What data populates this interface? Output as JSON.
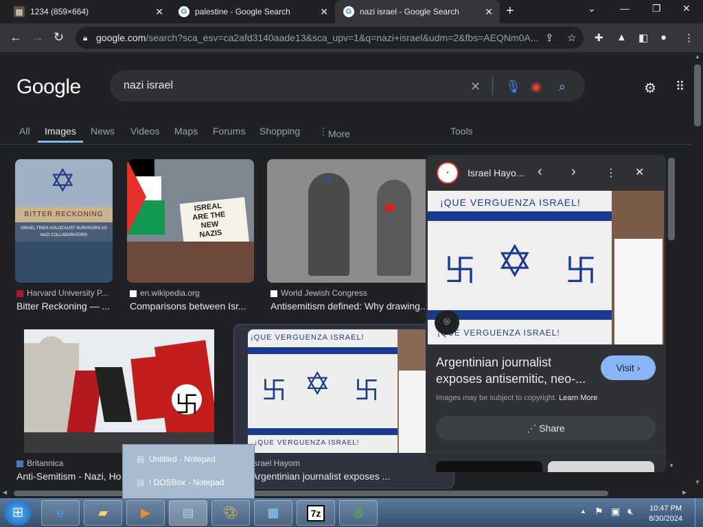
{
  "tabs": [
    {
      "title": "1234 (859×664)",
      "active": false
    },
    {
      "title": "palestine - Google Search",
      "active": false
    },
    {
      "title": "nazi israel - Google Search",
      "active": true
    }
  ],
  "address": {
    "host": "google.com",
    "path": "/search?sca_esv=ca2afd3140aade13&sca_upv=1&q=nazi+israel&udm=2&fbs=AEQNm0A..."
  },
  "logo": "Google",
  "search": {
    "query": "nazi israel"
  },
  "nav": {
    "all": "All",
    "images": "Images",
    "news": "News",
    "videos": "Videos",
    "maps": "Maps",
    "forums": "Forums",
    "shopping": "Shopping",
    "more": "More",
    "tools": "Tools"
  },
  "results": [
    {
      "source": "Harvard University P...",
      "title": "Bitter Reckoning — ...",
      "thumb_text": "BITTER RECKONING",
      "thumb_sub": "ISRAEL TRIES HOLOCAUST SURVIVORS AS NAZI COLLABORATORS"
    },
    {
      "source": "en.wikipedia.org",
      "title": "Comparisons between Isr...",
      "sign_text": "ISREAL ARE THE NEW NAZIS"
    },
    {
      "source": "World Jewish Congress",
      "title": "Antisemitism defined: Why drawing..."
    },
    {
      "source": "Britannica",
      "title": "Anti-Semitism - Nazi, Ho..."
    },
    {
      "source": "Israel Hayom",
      "title": "Argentinian journalist exposes ..."
    }
  ],
  "banner_text": "¡QUE VERGUENZA ISRAEL!",
  "panel": {
    "source": "Israel Hayo...",
    "title_line1": "Argentinian journalist",
    "title_line2": "exposes antisemitic, neo-...",
    "visit": "Visit",
    "copyright": "Images may be subject to copyright.",
    "learn_more": "Learn More",
    "share": "Share"
  },
  "jumplist": {
    "item1": "Untitled - Notepad",
    "item2": "! DOSBox - Notepad"
  },
  "taskbar": {
    "sevenzip": "7z"
  },
  "clock": {
    "time": "10:47 PM",
    "date": "8/30/2024"
  }
}
